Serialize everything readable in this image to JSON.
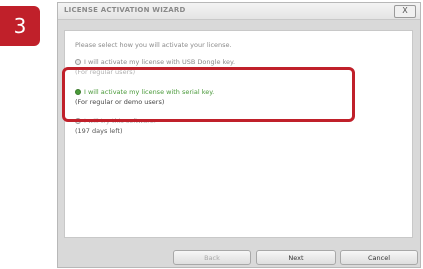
{
  "step": "3",
  "dialog": {
    "title": "LICENSE ACTIVATION WIZARD",
    "close_label": "X",
    "prompt": "Please select how you will activate your license.",
    "options": [
      {
        "label": "I will activate my license with USB Dongle key.",
        "sub": "(For regular users)",
        "selected": false
      },
      {
        "label": "I will activate my license with serial key.",
        "sub": "(For regular or demo users)",
        "selected": true
      },
      {
        "label": "I will try this software.",
        "sub": "(197 days left)",
        "selected": false
      }
    ],
    "buttons": {
      "back": "Back",
      "next": "Next",
      "cancel": "Cancel"
    }
  },
  "colors": {
    "accent": "#c0202a",
    "selected_text": "#4a9a3a"
  }
}
